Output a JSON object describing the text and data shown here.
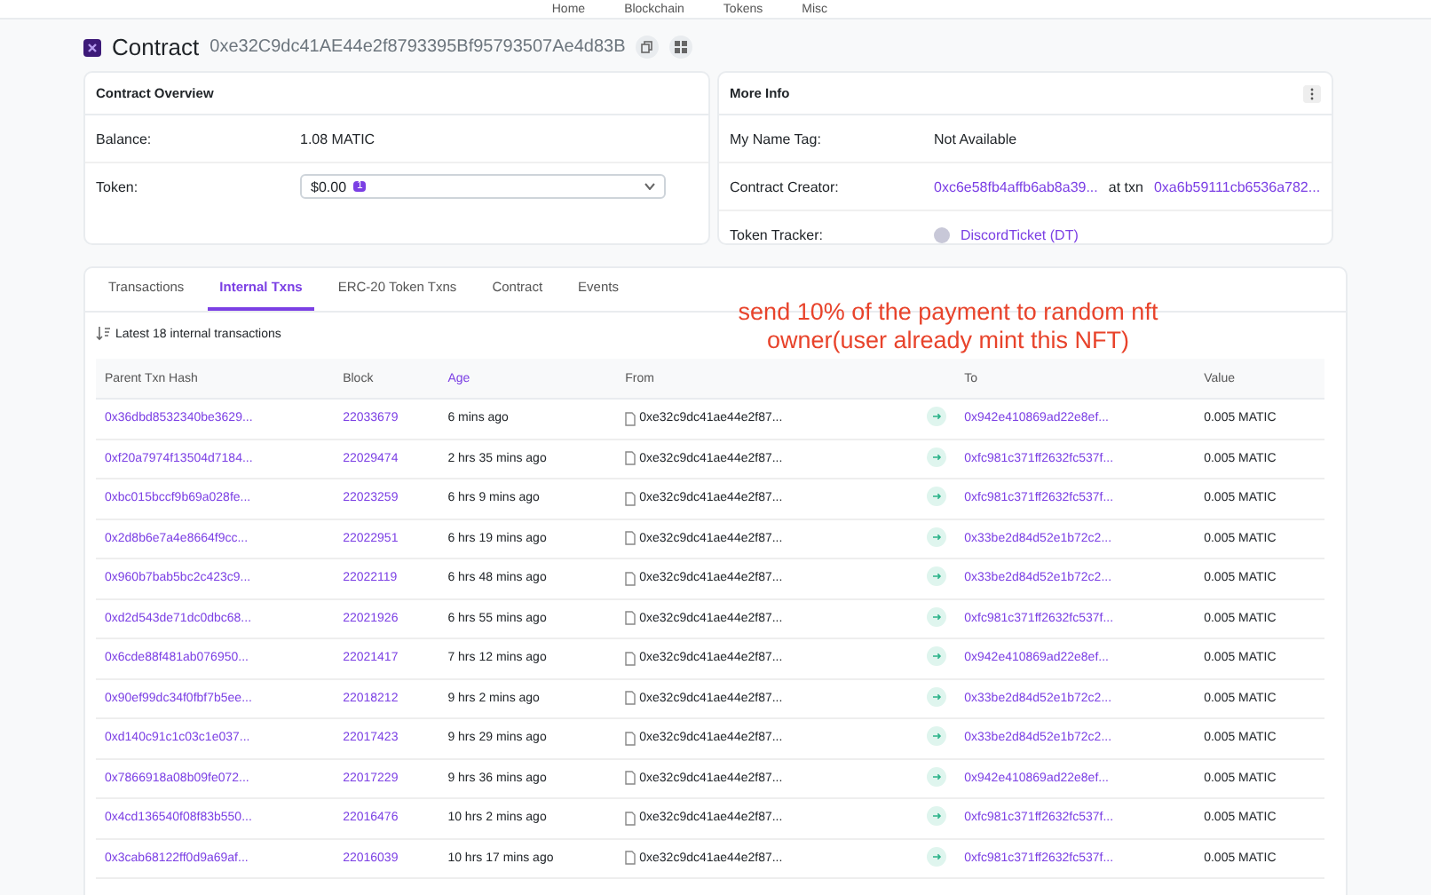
{
  "nav": [
    "Home",
    "Blockchain",
    "Tokens",
    "Misc"
  ],
  "header": {
    "title": "Contract",
    "address": "0xe32C9dc41AE44e2f8793395Bf95793507Ae4d83B"
  },
  "overview": {
    "title": "Contract Overview",
    "balance_label": "Balance:",
    "balance": "1.08 MATIC",
    "token_label": "Token:",
    "token_value": "$0.00",
    "token_count": "1"
  },
  "more_info": {
    "title": "More Info",
    "name_tag_label": "My Name Tag:",
    "name_tag": "Not Available",
    "creator_label": "Contract Creator:",
    "creator": "0xc6e58fb4affb6ab8a39...",
    "at_txn": "at txn",
    "creator_txn": "0xa6b59111cb6536a782...",
    "tracker_label": "Token Tracker:",
    "tracker": "DiscordTicket (DT)"
  },
  "tabs": [
    {
      "label": "Transactions",
      "selected": false
    },
    {
      "label": "Internal Txns",
      "selected": true
    },
    {
      "label": "ERC-20 Token Txns",
      "selected": false
    },
    {
      "label": "Contract",
      "selected": false
    },
    {
      "label": "Events",
      "selected": false
    }
  ],
  "summary": "Latest 18 internal transactions",
  "annotation": "send 10% of the payment to random nft owner(user already mint this NFT)",
  "table": {
    "columns": [
      "Parent Txn Hash",
      "Block",
      "Age",
      "From",
      "To",
      "Value"
    ],
    "rows": [
      [
        "0x36dbd8532340be3629...",
        "22033679",
        "6 mins ago",
        "0xe32c9dc41ae44e2f87...",
        "0x942e410869ad22e8ef...",
        "0.005 MATIC"
      ],
      [
        "0xf20a7974f13504d7184...",
        "22029474",
        "2 hrs 35 mins ago",
        "0xe32c9dc41ae44e2f87...",
        "0xfc981c371ff2632fc537f...",
        "0.005 MATIC"
      ],
      [
        "0xbc015bccf9b69a028fe...",
        "22023259",
        "6 hrs 9 mins ago",
        "0xe32c9dc41ae44e2f87...",
        "0xfc981c371ff2632fc537f...",
        "0.005 MATIC"
      ],
      [
        "0x2d8b6e7a4e8664f9cc...",
        "22022951",
        "6 hrs 19 mins ago",
        "0xe32c9dc41ae44e2f87...",
        "0x33be2d84d52e1b72c2...",
        "0.005 MATIC"
      ],
      [
        "0x960b7bab5bc2c423c9...",
        "22022119",
        "6 hrs 48 mins ago",
        "0xe32c9dc41ae44e2f87...",
        "0x33be2d84d52e1b72c2...",
        "0.005 MATIC"
      ],
      [
        "0xd2d543de71dc0dbc68...",
        "22021926",
        "6 hrs 55 mins ago",
        "0xe32c9dc41ae44e2f87...",
        "0xfc981c371ff2632fc537f...",
        "0.005 MATIC"
      ],
      [
        "0x6cde88f481ab076950...",
        "22021417",
        "7 hrs 12 mins ago",
        "0xe32c9dc41ae44e2f87...",
        "0x942e410869ad22e8ef...",
        "0.005 MATIC"
      ],
      [
        "0x90ef99dc34f0fbf7b5ee...",
        "22018212",
        "9 hrs 2 mins ago",
        "0xe32c9dc41ae44e2f87...",
        "0x33be2d84d52e1b72c2...",
        "0.005 MATIC"
      ],
      [
        "0xd140c91c1c03c1e037...",
        "22017423",
        "9 hrs 29 mins ago",
        "0xe32c9dc41ae44e2f87...",
        "0x33be2d84d52e1b72c2...",
        "0.005 MATIC"
      ],
      [
        "0x7866918a08b09fe072...",
        "22017229",
        "9 hrs 36 mins ago",
        "0xe32c9dc41ae44e2f87...",
        "0x942e410869ad22e8ef...",
        "0.005 MATIC"
      ],
      [
        "0x4cd136540f08f83b550...",
        "22016476",
        "10 hrs 2 mins ago",
        "0xe32c9dc41ae44e2f87...",
        "0xfc981c371ff2632fc537f...",
        "0.005 MATIC"
      ],
      [
        "0x3cab68122ff0d9a69af...",
        "22016039",
        "10 hrs 17 mins ago",
        "0xe32c9dc41ae44e2f87...",
        "0xfc981c371ff2632fc537f...",
        "0.005 MATIC"
      ]
    ]
  }
}
